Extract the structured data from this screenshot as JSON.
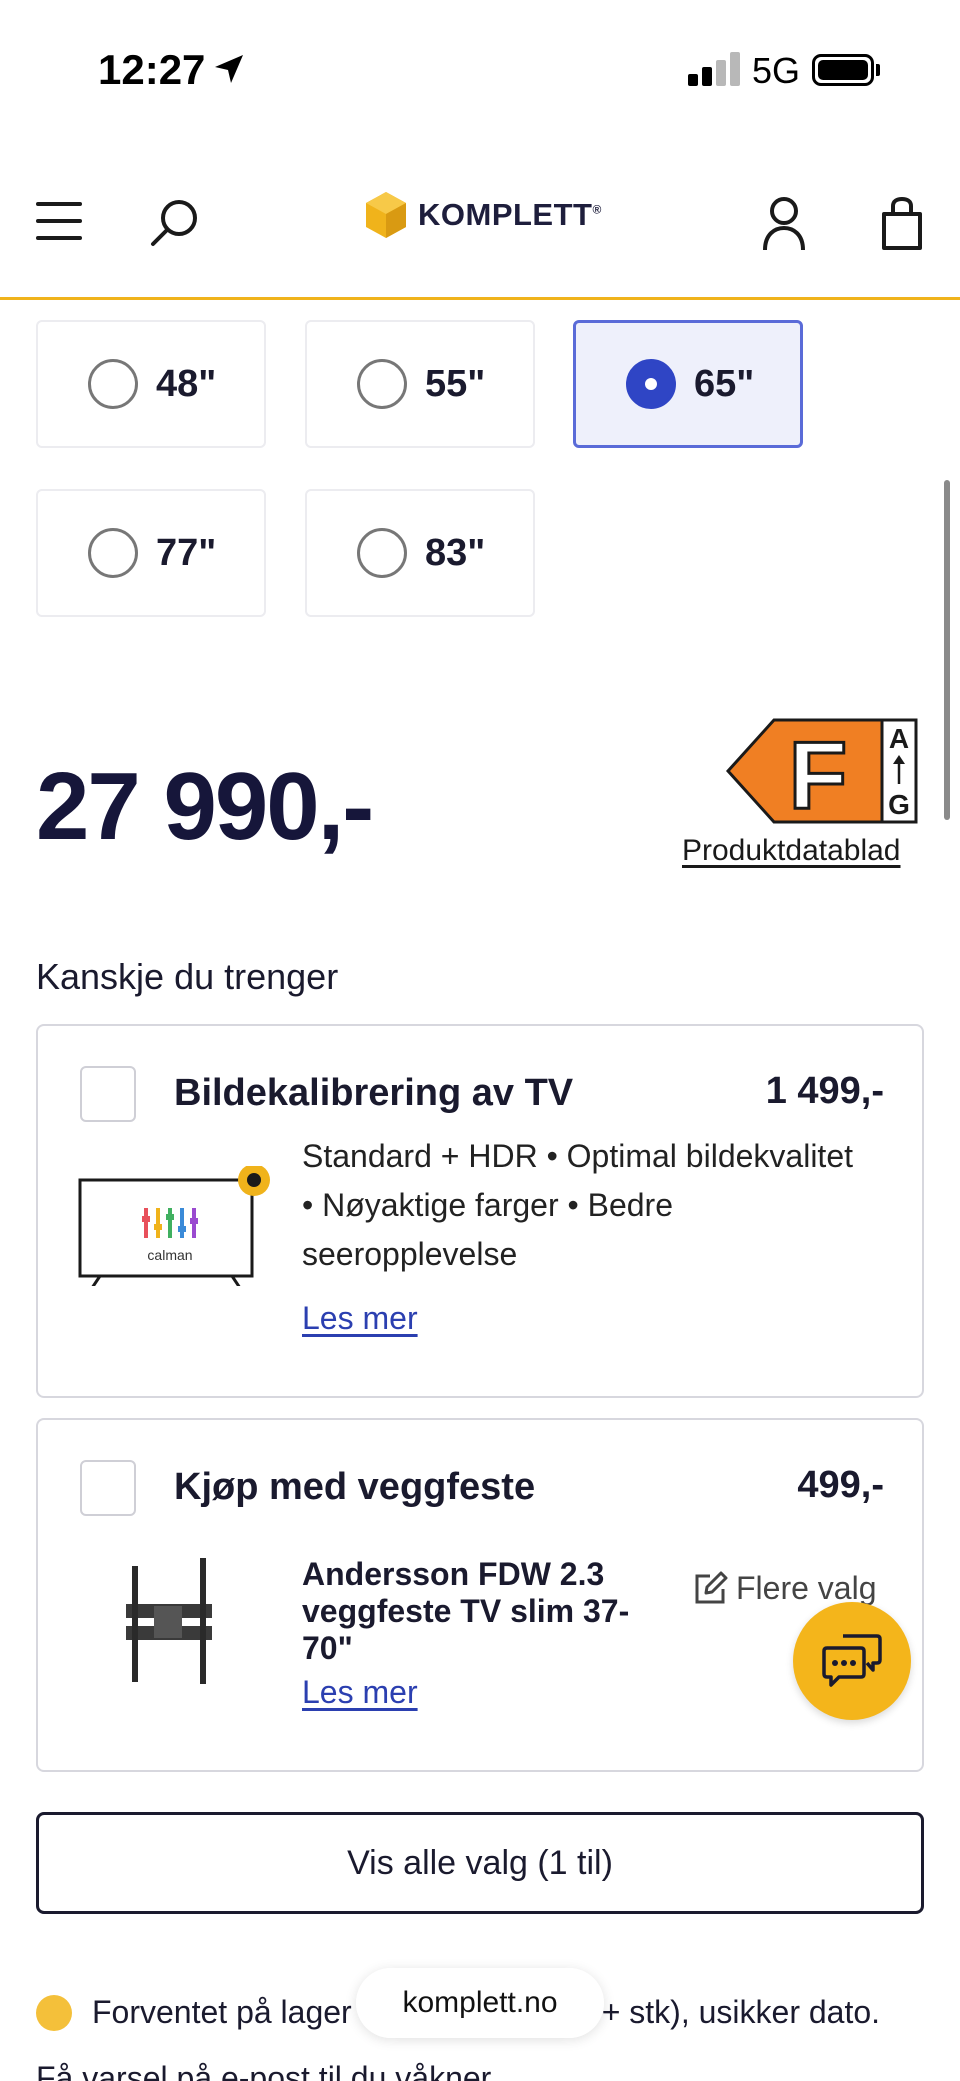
{
  "status_bar": {
    "time": "12:27",
    "network": "5G"
  },
  "header": {
    "logo_text": "KOMPLETT",
    "logo_reg": "®",
    "icons": [
      "menu-icon",
      "search-icon",
      "user-icon",
      "cart-icon"
    ],
    "accent_color": "#f0b31b"
  },
  "sizes": [
    {
      "label": "48\"",
      "selected": false
    },
    {
      "label": "55\"",
      "selected": false
    },
    {
      "label": "65\"",
      "selected": true
    },
    {
      "label": "77\"",
      "selected": false
    },
    {
      "label": "83\"",
      "selected": false
    }
  ],
  "price": "27 990,-",
  "energy": {
    "class": "F",
    "scale_top": "A",
    "scale_bottom": "G",
    "class_color": "#f07f23",
    "datasheet_link": "Produktdatablad"
  },
  "suggestions": {
    "title": "Kanskje du trenger",
    "calibration": {
      "title": "Bildekalibrering av TV",
      "price": "1 499,-",
      "desc_line1": "Standard + HDR • Optimal bildekvalitet",
      "desc_line2": "• Nøyaktige farger • Bedre",
      "desc_line3": "seeropplevelse",
      "read_more": "Les mer",
      "image_brand": "calman"
    },
    "wall_mount": {
      "title": "Kjøp med veggfeste",
      "price": "499,-",
      "product_line1": "Andersson FDW 2.3",
      "product_line2": "veggfeste TV slim 37-",
      "product_line3": "70\"",
      "read_more": "Les mer",
      "more_options": "Flere valg"
    },
    "show_all": "Vis alle valg (1 til)"
  },
  "stock": {
    "text_before": "Forventet på lager",
    "text_after": "+ stk), usikker dato.",
    "status_color": "#f4c03a"
  },
  "url_pill": "komplett.no",
  "bottom_partial": "Få varsel på e-post til du våkner"
}
